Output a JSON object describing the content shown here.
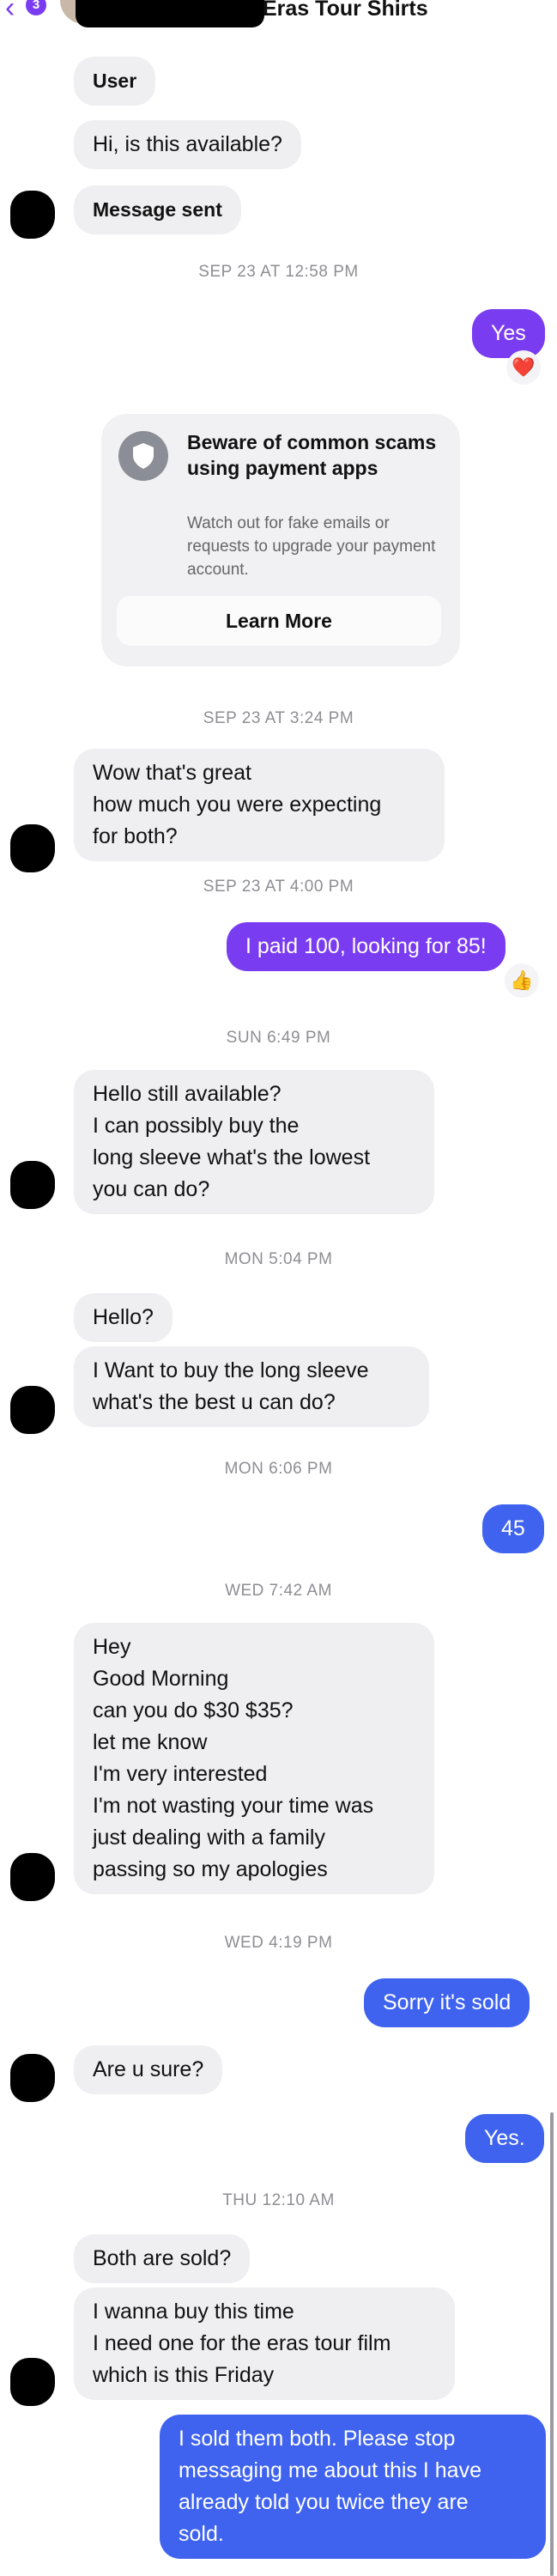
{
  "header": {
    "title": "Eras Tour Shirts",
    "back_count": "3"
  },
  "colors": {
    "outgoing_purple": "#7a3cf0",
    "outgoing_blue": "#3f63ee",
    "incoming_gray": "#efeff1"
  },
  "messages": {
    "m1": "User",
    "m2": "Hi, is this available?",
    "m3": "Message sent",
    "m4": "Yes",
    "m5_l1": "Wow that's great",
    "m5_l2": "how much you were expecting",
    "m5_l3": "for both?",
    "m6": "I paid 100, looking for 85!",
    "m7_l1": "Hello still available?",
    "m7_l2": "I can possibly buy the",
    "m7_l3": "long sleeve what's the lowest",
    "m7_l4": "you can do?",
    "m8": "Hello?",
    "m9_l1": "I Want to buy the long sleeve",
    "m9_l2": "what's the best u can do?",
    "m10": "45",
    "m11_l1": "Hey",
    "m11_l2": "Good Morning",
    "m11_l3": "can you do $30 $35?",
    "m11_l4": "let me know",
    "m11_l5": "I'm very interested",
    "m12_l1": "I'm not wasting your time was",
    "m12_l2": "just dealing with a family",
    "m12_l3": "passing so my apologies",
    "m13": "Sorry it's sold",
    "m14": "Are u sure?",
    "m15": "Yes.",
    "m16": "Both are sold?",
    "m17_l1": "I wanna buy this time",
    "m17_l2": "I need one for the eras tour film",
    "m17_l3": "which is this Friday",
    "m18_l1": "I sold them both. Please stop",
    "m18_l2": "messaging me about this I have",
    "m18_l3": "already told you twice they are",
    "m18_l4": "sold."
  },
  "timestamps": {
    "t1": "SEP 23 AT 12:58 PM",
    "t2": "SEP 23 AT 3:24 PM",
    "t3": "SEP 23 AT 4:00 PM",
    "t4": "SUN 6:49 PM",
    "t5": "MON 5:04 PM",
    "t6": "MON 6:06 PM",
    "t7": "WED 7:42 AM",
    "t8": "WED 4:19 PM",
    "t9": "THU 12:10 AM"
  },
  "reactions": {
    "r1": "❤️",
    "r2": "👍"
  },
  "safety_card": {
    "title": "Beware of common scams using payment apps",
    "body": "Watch out for fake emails or requests to upgrade your payment account.",
    "button": "Learn More"
  }
}
